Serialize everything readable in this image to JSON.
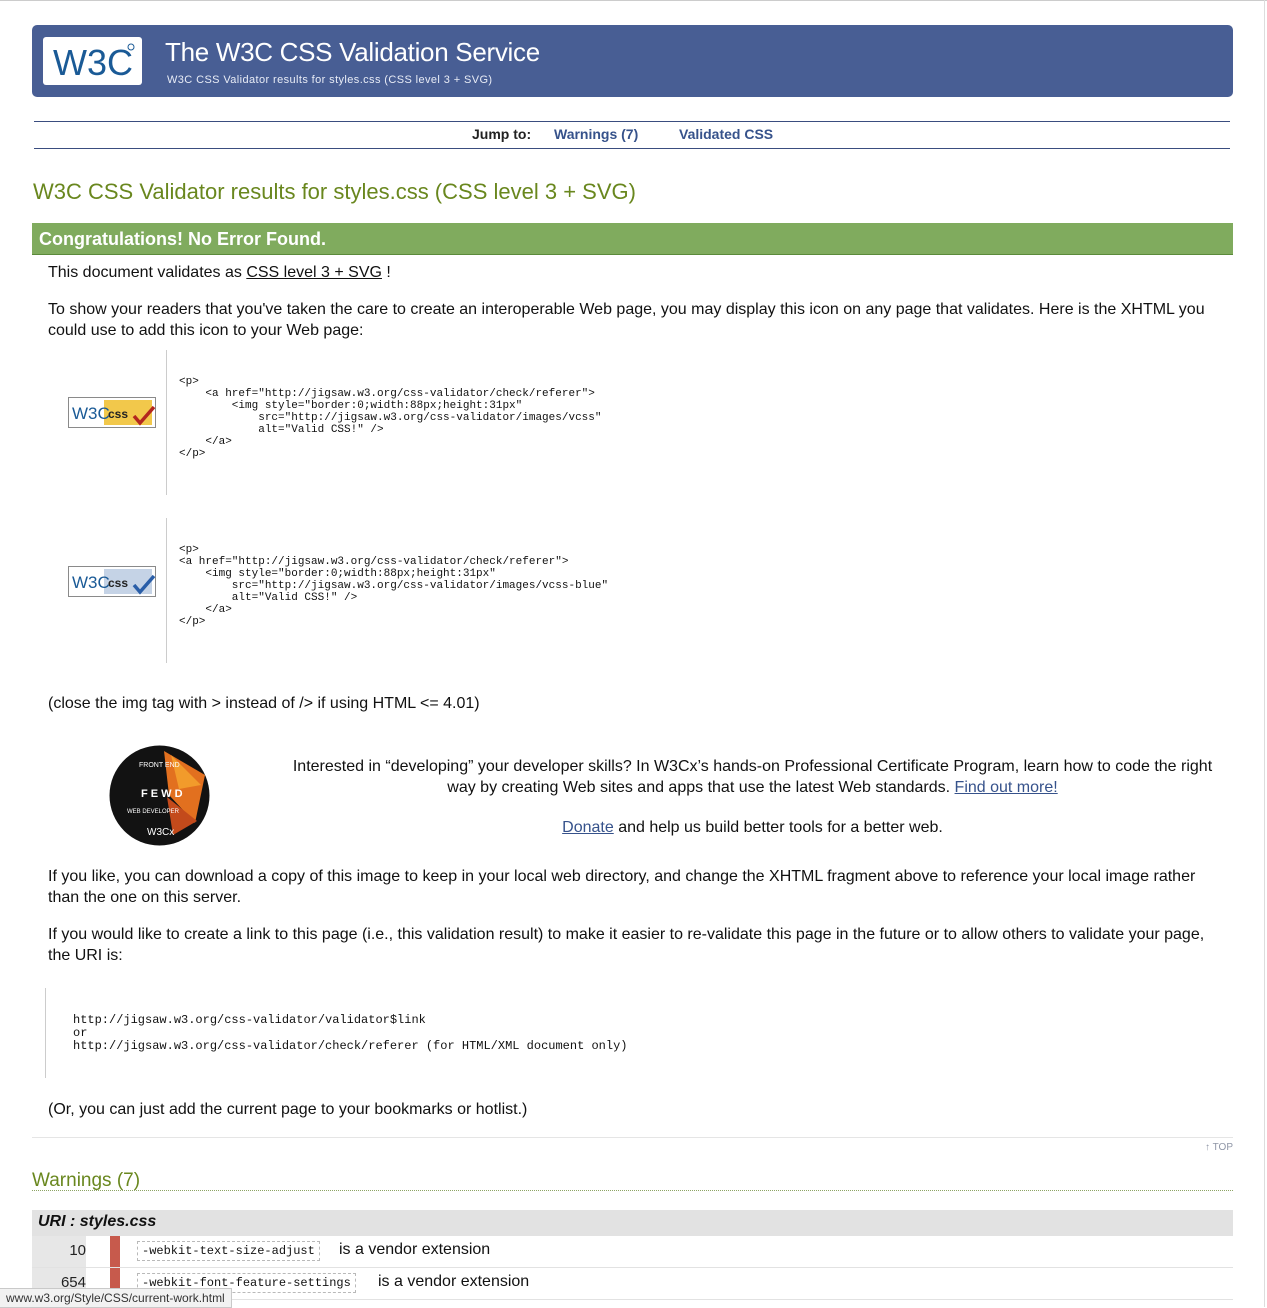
{
  "banner": {
    "logo_text": "W3C",
    "title": "The W3C CSS Validation Service",
    "subtitle": "W3C CSS Validator results for styles.css (CSS level 3 + SVG)"
  },
  "jump": {
    "label": "Jump to:",
    "warnings": "Warnings (7)",
    "validated": "Validated CSS"
  },
  "results_heading": "W3C CSS Validator results for styles.css (CSS level 3 + SVG)",
  "congrats": "Congratulations! No Error Found.",
  "validates": {
    "prefix": "This document validates as",
    "link": "CSS level 3 + SVG",
    "suffix": "!"
  },
  "icon_intro": "To show your readers that you've taken the care to create an interoperable Web page, you may display this icon on any page that validates. Here is the XHTML you could use to add this icon to your Web page:",
  "badges": {
    "text": "W3C",
    "label": "css"
  },
  "code1": "<p>\n    <a href=\"http://jigsaw.w3.org/css-validator/check/referer\">\n        <img style=\"border:0;width:88px;height:31px\"\n            src=\"http://jigsaw.w3.org/css-validator/images/vcss\"\n            alt=\"Valid CSS!\" />\n    </a>\n</p>",
  "code2": "<p>\n<a href=\"http://jigsaw.w3.org/css-validator/check/referer\">\n    <img style=\"border:0;width:88px;height:31px\"\n        src=\"http://jigsaw.w3.org/css-validator/images/vcss-blue\"\n        alt=\"Valid CSS!\" />\n    </a>\n</p>",
  "img_note": "(close the img tag with > instead of /> if using HTML <= 4.01)",
  "fewd_badge": {
    "top": "FRONT END",
    "letters": "F E W D",
    "side": "WEB DEVELOPER",
    "bottom": "W3Cx"
  },
  "promo": {
    "text": "Interested in “developing” your developer skills? In W3Cx’s hands-on Professional Certificate Program, learn how to code the right way by creating Web sites and apps that use the latest Web standards.",
    "link": "Find out more!"
  },
  "donate": {
    "link": "Donate",
    "text": "and help us build better tools for a better web."
  },
  "download_para": "If you like, you can download a copy of this image to keep in your local web directory, and change the XHTML fragment above to reference your local image rather than the one on this server.",
  "link_para": "If you would like to create a link to this page (i.e., this validation result) to make it easier to re-validate this page in the future or to allow others to validate your page, the URI is:",
  "uri_block": "http://jigsaw.w3.org/css-validator/validator$link\nor\nhttp://jigsaw.w3.org/css-validator/check/referer (for HTML/XML document only)",
  "bookmark_para": "(Or, you can just add the current page to your bookmarks or hotlist.)",
  "top_link": "↑ TOP",
  "warnings": {
    "heading": "Warnings (7)",
    "uri": "URI : styles.css",
    "rows": [
      {
        "line": "10",
        "property": "-webkit-text-size-adjust",
        "message": "is a vendor extension"
      },
      {
        "line": "654",
        "property": "-webkit-font-feature-settings",
        "message": "is a vendor extension"
      }
    ]
  },
  "status_url": "www.w3.org/Style/CSS/current-work.html",
  "colors": {
    "banner": "#485e94",
    "heading_green": "#69871e",
    "congrats_bar": "#80ab5e",
    "link_blue": "#36528b",
    "warning_marker": "#c75a4c"
  }
}
